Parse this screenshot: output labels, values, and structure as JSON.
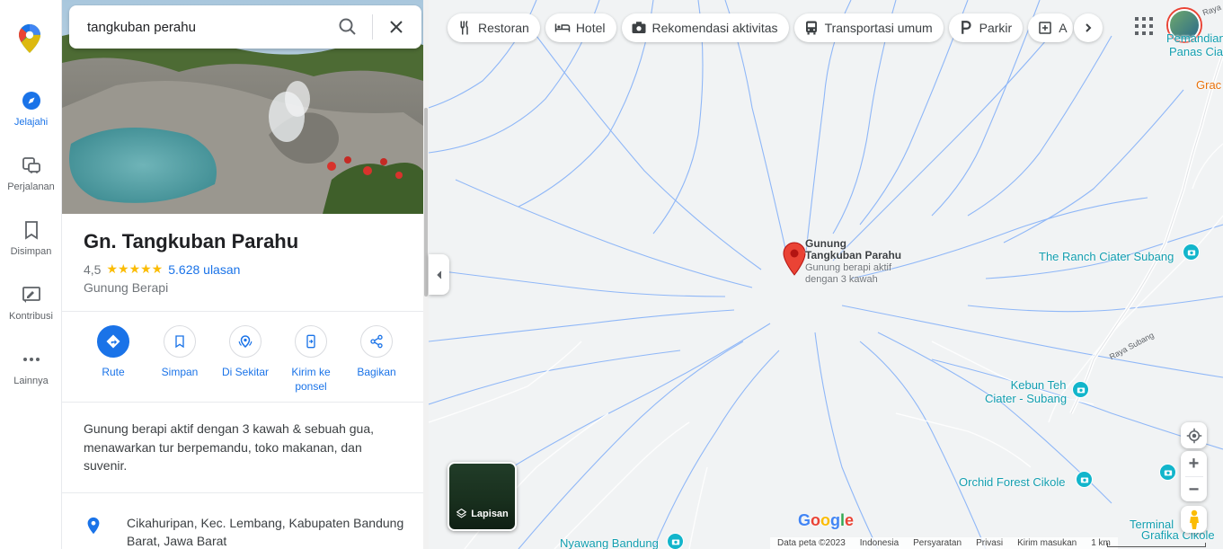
{
  "search": {
    "query": "tangkuban perahu"
  },
  "rail": [
    {
      "label": "Jelajahi"
    },
    {
      "label": "Perjalanan"
    },
    {
      "label": "Disimpan"
    },
    {
      "label": "Kontribusi"
    },
    {
      "label": "Lainnya"
    }
  ],
  "place": {
    "title": "Gn. Tangkuban Parahu",
    "rating": "4,5",
    "stars": "★★★★★",
    "reviews": "5.628 ulasan",
    "category": "Gunung Berapi",
    "description": "Gunung berapi aktif dengan 3 kawah & sebuah gua, menawarkan tur berpemandu, toko makanan, dan suvenir.",
    "address": "Cikahuripan, Kec. Lembang, Kabupaten Bandung Barat, Jawa Barat"
  },
  "actions": [
    {
      "label": "Rute"
    },
    {
      "label": "Simpan"
    },
    {
      "label": "Di Sekitar"
    },
    {
      "label": "Kirim ke ponsel"
    },
    {
      "label": "Bagikan"
    }
  ],
  "chips": [
    {
      "label": "Restoran",
      "icon": "fork-knife-icon"
    },
    {
      "label": "Hotel",
      "icon": "bed-icon"
    },
    {
      "label": "Rekomendasi aktivitas",
      "icon": "camera-icon"
    },
    {
      "label": "Transportasi umum",
      "icon": "bus-icon"
    },
    {
      "label": "Parkir",
      "icon": "parking-icon"
    },
    {
      "label": "A",
      "icon": "pharmacy-icon"
    }
  ],
  "map": {
    "pin_title_1": "Gunung",
    "pin_title_2": "Tangkuban Parahu",
    "pin_sub_1": "Gunung berapi aktif",
    "pin_sub_2": "dengan 3 kawah",
    "poi_ranch": "The Ranch Ciater Subang",
    "poi_kebun_1": "Kebun Teh",
    "poi_kebun_2": "Ciater - Subang",
    "poi_orchid": "Orchid Forest Cikole",
    "poi_nyawang": "Nyawang Bandung",
    "poi_terminal_1": "Terminal",
    "poi_terminal_2": "Grafika Cikole",
    "poi_pemandian_1": "Pemandian",
    "poi_pemandian_2": "Panas Cia",
    "poi_grac": "Grac",
    "road_subang": "Raya Subang",
    "road_top": "Raya",
    "layers_label": "Lapisan",
    "google": "Google"
  },
  "footer": {
    "data": "Data peta ©2023",
    "country": "Indonesia",
    "terms": "Persyaratan",
    "privacy": "Privasi",
    "feedback": "Kirim masukan",
    "scale": "1 km"
  },
  "colors": {
    "accent": "#1a73e8",
    "pin": "#ea4335",
    "poi": "#129eaf",
    "star": "#fbbc04"
  }
}
